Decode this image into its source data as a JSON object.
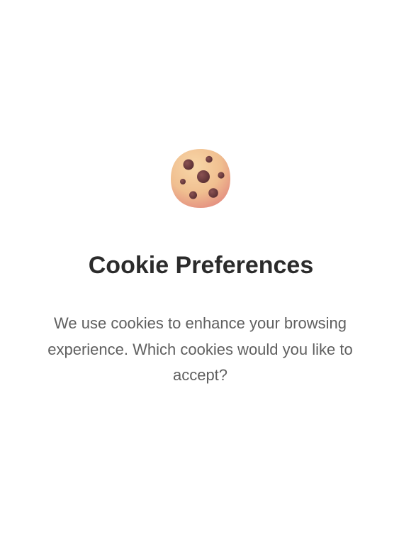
{
  "dialog": {
    "icon": "cookie-icon",
    "title": "Cookie Preferences",
    "description": "We use cookies to enhance your browsing experience. Which cookies would you like to accept?"
  },
  "colors": {
    "background": "#ffffff",
    "title": "#2b2b2b",
    "description": "#5f5f5f",
    "cookie_light": "#f4cfa0",
    "cookie_dark": "#e49a86",
    "chip": "#6b3b3b"
  }
}
